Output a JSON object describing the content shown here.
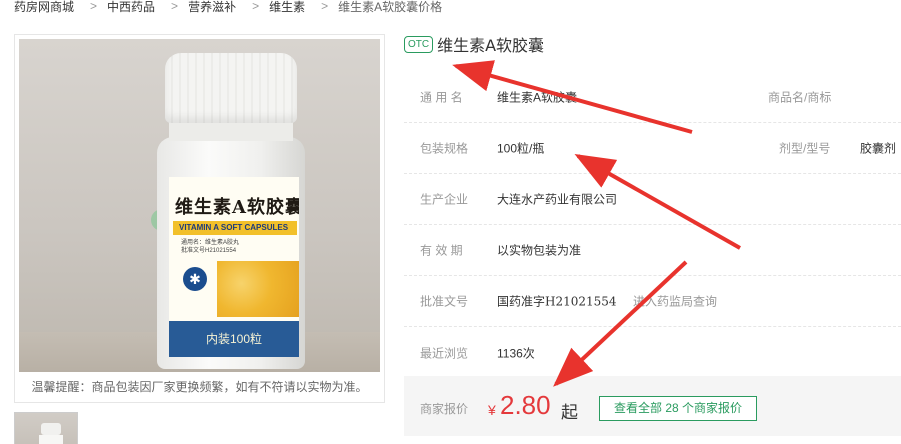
{
  "breadcrumb": {
    "items": [
      "药房网商城",
      "中西药品",
      "营养滋补",
      "维生素",
      "维生素A软胶囊价格"
    ],
    "separator": ">"
  },
  "gallery": {
    "label": {
      "name": "维生素A软胶囊",
      "english": "VITAMIN A SOFT CAPSULES",
      "line1": "通用名：维生素A胶丸",
      "line2": "批准文号H21021554",
      "count": "内装100粒"
    },
    "tip": "温馨提醒：商品包装因厂家更换频繁，如有不符请以实物为准。"
  },
  "product": {
    "badge": "OTC",
    "title": "维生素A软胶囊"
  },
  "attrs": {
    "generic_name_label": "通 用 名",
    "generic_name": "维生素A软胶囊",
    "brand_label": "商品名/商标",
    "spec_label": "包装规格",
    "spec": "100粒/瓶",
    "form_label": "剂型/型号",
    "form": "胶囊剂",
    "maker_label": "生产企业",
    "maker": "大连水产药业有限公司",
    "expiry_label": "有 效 期",
    "expiry": "以实物包装为准",
    "approval_label": "批准文号",
    "approval": "国药准字H21021554",
    "approval_link": "进入药监局查询",
    "views_label": "最近浏览",
    "views": "1136次"
  },
  "price": {
    "label": "商家报价",
    "currency": "¥",
    "amount": "2.80",
    "suffix": "起",
    "button": "查看全部 28 个商家报价"
  },
  "colors": {
    "accent_green": "#2a9b5f",
    "price_red": "#e4393c",
    "annotation_red": "#e8332d"
  },
  "icons": {
    "otc": "otc-badge",
    "annotation": "red-arrow"
  }
}
